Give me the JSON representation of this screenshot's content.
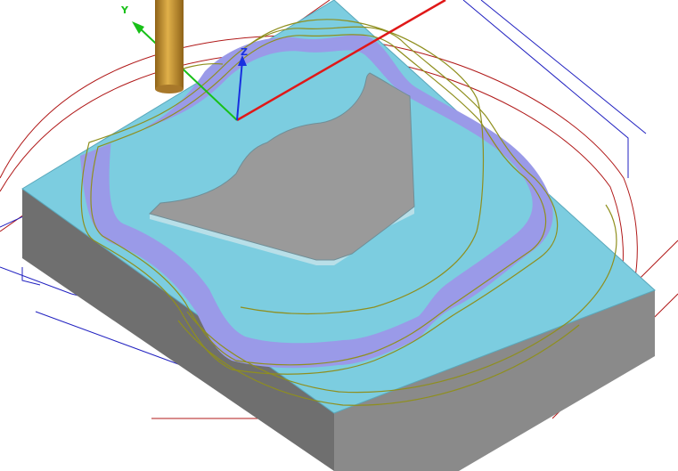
{
  "viewport": {
    "axes": {
      "x_label": "",
      "y_label": "Y",
      "z_label": "Z"
    },
    "colors": {
      "background": "#ffffff",
      "stock_top": "#7ccde0",
      "stock_side_right": "#8a8a8a",
      "stock_side_front": "#6f6f6f",
      "pocket_floor": "#7ccde0",
      "pocket_wall": "#9a9ae8",
      "boss_top": "#9a9a9a",
      "boss_edge": "#b8dfe8",
      "tool": "#c9952e",
      "toolpath": "#8f8f1e",
      "x_axis": "#e01818",
      "y_axis": "#18c018",
      "z_axis": "#1830e0",
      "wire_red": "#b01818",
      "wire_blue": "#2020c0"
    },
    "icons": [
      "tool-icon",
      "axis-triad-icon"
    ]
  }
}
